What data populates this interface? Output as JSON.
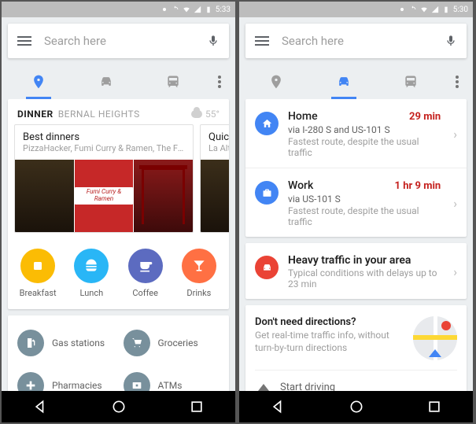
{
  "status": {
    "time_left": "5:33",
    "time_right": "5:30"
  },
  "search": {
    "placeholder": "Search here"
  },
  "tabs": [
    "explore",
    "drive",
    "transit",
    "more"
  ],
  "left": {
    "dinner_label": "DINNER",
    "area": "BERNAL HEIGHTS",
    "temp": "55°",
    "carousel": [
      {
        "title": "Best dinners",
        "subtitle": "PizzaHacker, Fumi Curry & Ramen, The Front…",
        "sign": "Fumi Curry & Ramen"
      },
      {
        "title": "Quick",
        "subtitle": "La Alt"
      }
    ],
    "categories": [
      {
        "label": "Breakfast",
        "icon": "bread-icon",
        "color": "c-yellow"
      },
      {
        "label": "Lunch",
        "icon": "burger-icon",
        "color": "c-blue"
      },
      {
        "label": "Coffee",
        "icon": "coffee-icon",
        "color": "c-indigo"
      },
      {
        "label": "Drinks",
        "icon": "cocktail-icon",
        "color": "c-orange"
      }
    ],
    "services": [
      {
        "label": "Gas stations",
        "icon": "gas-icon"
      },
      {
        "label": "Groceries",
        "icon": "cart-icon"
      },
      {
        "label": "Pharmacies",
        "icon": "pharmacy-icon"
      },
      {
        "label": "ATMs",
        "icon": "atm-icon"
      }
    ]
  },
  "right": {
    "destinations": [
      {
        "name": "Home",
        "icon": "home-icon",
        "time": "29 min",
        "via": "via I-280 S and US-101 S",
        "status": "Fastest route, despite the usual traffic"
      },
      {
        "name": "Work",
        "icon": "briefcase-icon",
        "time": "1 hr 9 min",
        "via": "via US-101 S",
        "status": "Fastest route, despite the usual traffic"
      }
    ],
    "traffic": {
      "title": "Heavy traffic in your area",
      "sub": "Typical conditions with delays up to 23 min"
    },
    "info": {
      "title": "Don't need directions?",
      "sub": "Get real-time traffic info, without turn-by-turn directions",
      "start": "Start driving"
    }
  }
}
